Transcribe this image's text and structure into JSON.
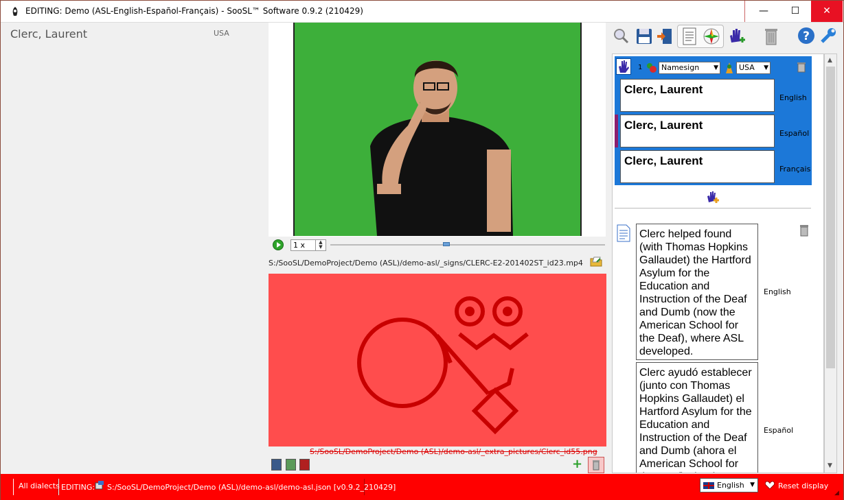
{
  "window": {
    "title": "EDITING: Demo (ASL-English-Español-Français) - SooSL™ Software 0.9.2 (210429)",
    "minimize": "—",
    "maximize": "☐",
    "close": "✕"
  },
  "sign_list": {
    "items": [
      {
        "name": "Clerc, Laurent",
        "country": "USA"
      }
    ]
  },
  "video": {
    "speed": "1 x",
    "path": "S:/SooSL/DemoProject/Demo (ASL)/demo-asl/_signs/CLERC-E2-201402ST_id23.mp4",
    "progress": 0.42
  },
  "picture": {
    "path": "S:/SooSL/DemoProject/Demo (ASL)/demo-asl/_extra_pictures/Clerc_id55.png"
  },
  "sense": {
    "number": "1",
    "grammar_category": "Namesign",
    "dialect": "USA",
    "glosses": [
      {
        "text": "Clerc, Laurent",
        "language": "English"
      },
      {
        "text": "Clerc, Laurent",
        "language": "Español"
      },
      {
        "text": "Clerc, Laurent",
        "language": "Français"
      }
    ]
  },
  "notes": [
    {
      "text": "Clerc helped found (with Thomas Hopkins Gallaudet) the Hartford Asylum for the Education and Instruction of the Deaf and Dumb (now the American School for the Deaf), where ASL developed.",
      "language": "English"
    },
    {
      "text": "Clerc ayudó establecer (junto con Thomas Hopkins Gallaudet) el Hartford Asylum for the Education and Instruction of the Deaf and Dumb (ahora el American School for the Deaf), donde se",
      "language": "Español"
    }
  ],
  "status_bar": {
    "dialects": "All dialects",
    "editing_label": "EDITING:",
    "file": "S:/SooSL/DemoProject/Demo (ASL)/demo-asl/demo-asl.json [v0.9.2_210429]",
    "display_language": "English",
    "reset": "Reset display"
  },
  "colors": {
    "accent": "#1c78d8",
    "status": "#ff0000",
    "picture_bg": "#ff4d4d",
    "video_bg": "#3daf3a"
  }
}
